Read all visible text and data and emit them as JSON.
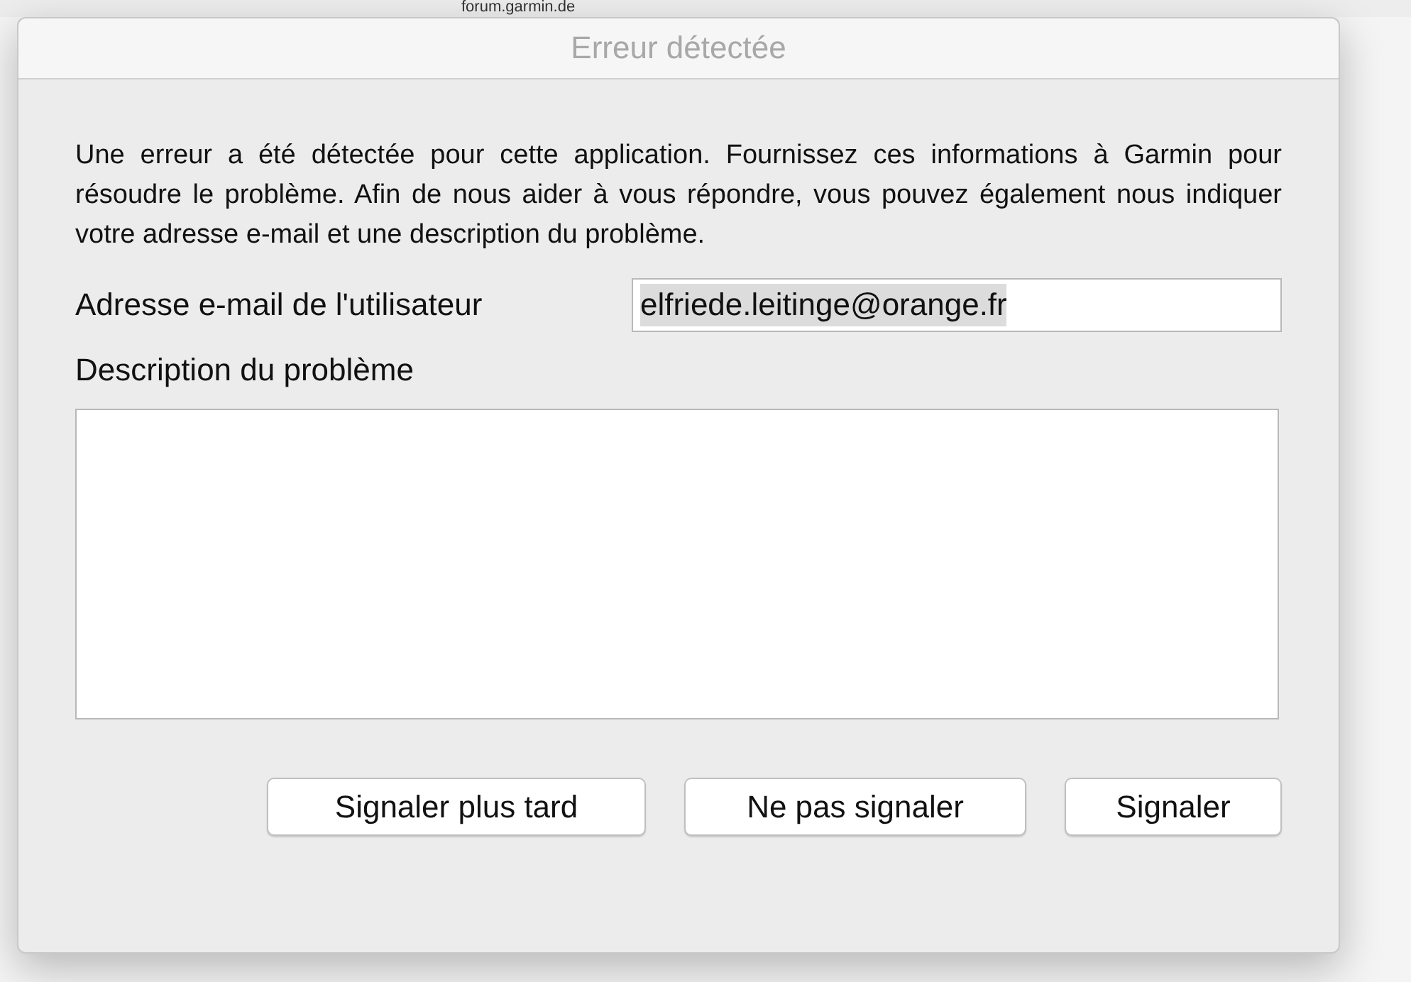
{
  "background": {
    "address": "forum.garmin.de"
  },
  "window": {
    "title": "Erreur détectée"
  },
  "message": "Une erreur a été détectée pour cette application. Fournissez ces informations à Garmin pour résoudre le problème. Afin de nous aider à vous répondre, vous pouvez également nous indiquer votre adresse e-mail et une description du problème.",
  "email": {
    "label": "Adresse e-mail de l'utilisateur",
    "value": "elfriede.leitinge@orange.fr",
    "text_selected": true
  },
  "description": {
    "label": "Description du problème"
  },
  "buttons": [
    {
      "label": "Signaler plus tard"
    },
    {
      "label": "Ne pas signaler"
    },
    {
      "label": "Signaler"
    }
  ]
}
